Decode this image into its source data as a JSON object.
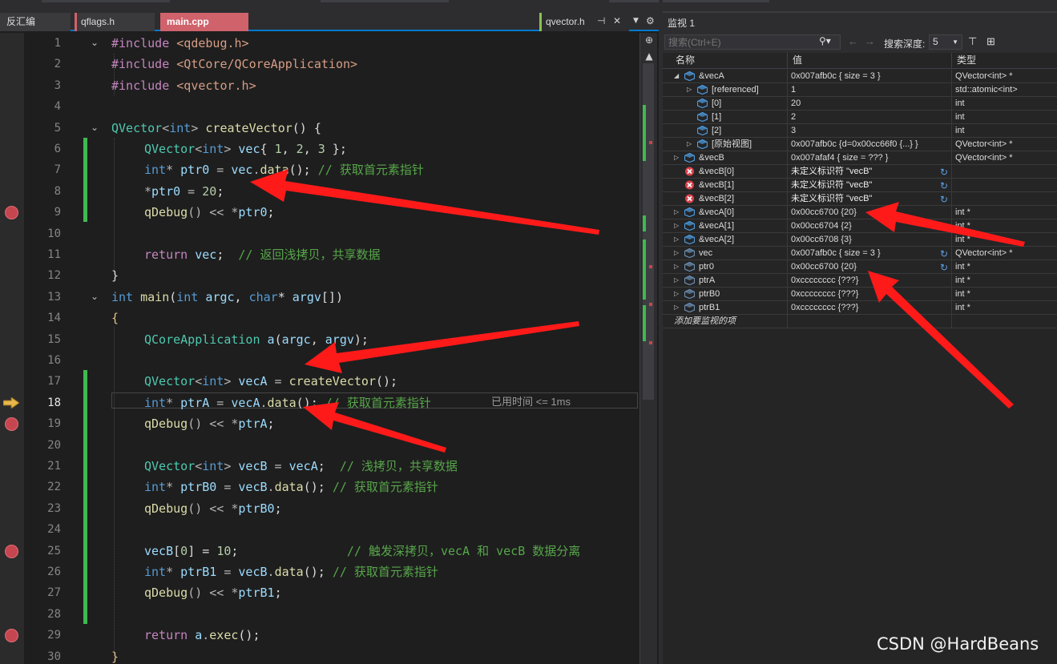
{
  "tabs": {
    "disasm": "反汇编",
    "qflags": "qflags.h",
    "main": "main.cpp",
    "qvector": "qvector.h"
  },
  "editor": {
    "timing_text": "已用时间 <= 1ms",
    "lines": [
      {
        "n": "1"
      },
      {
        "n": "2"
      },
      {
        "n": "3"
      },
      {
        "n": "4"
      },
      {
        "n": "5"
      },
      {
        "n": "6"
      },
      {
        "n": "7"
      },
      {
        "n": "8"
      },
      {
        "n": "9"
      },
      {
        "n": "10"
      },
      {
        "n": "11"
      },
      {
        "n": "12"
      },
      {
        "n": "13"
      },
      {
        "n": "14"
      },
      {
        "n": "15"
      },
      {
        "n": "16"
      },
      {
        "n": "17"
      },
      {
        "n": "18"
      },
      {
        "n": "19"
      },
      {
        "n": "20"
      },
      {
        "n": "21"
      },
      {
        "n": "22"
      },
      {
        "n": "23"
      },
      {
        "n": "24"
      },
      {
        "n": "25"
      },
      {
        "n": "26"
      },
      {
        "n": "27"
      },
      {
        "n": "28"
      },
      {
        "n": "29"
      },
      {
        "n": "30"
      }
    ],
    "code": {
      "l1": [
        "#include",
        " <qdebug.h>"
      ],
      "l2": [
        "#include",
        " <QtCore/QCoreApplication>"
      ],
      "l3": [
        "#include",
        " <qvector.h>"
      ],
      "l5": [
        "QVector",
        "<",
        "int",
        "> ",
        "createVector",
        "() {"
      ],
      "l6": [
        "QVector",
        "<",
        "int",
        "> ",
        "vec",
        "{ ",
        "1",
        ", ",
        "2",
        ", ",
        "3",
        " };"
      ],
      "l7": [
        "int",
        "* ",
        "ptr0",
        " = ",
        "vec",
        ".",
        "data",
        "(); ",
        "// 获取首元素指针"
      ],
      "l8": [
        "*",
        "ptr0",
        " = ",
        "20",
        ";"
      ],
      "l9": [
        "qDebug",
        "() << *",
        "ptr0",
        ";"
      ],
      "l11": [
        "return",
        " ",
        "vec",
        ";  ",
        "// 返回浅拷贝，共享数据"
      ],
      "l12": [
        "}"
      ],
      "l13": [
        "int",
        " ",
        "main",
        "(",
        "int",
        " ",
        "argc",
        ", ",
        "char",
        "* ",
        "argv",
        "[])"
      ],
      "l14": [
        "{"
      ],
      "l15": [
        "QCoreApplication",
        " ",
        "a",
        "(",
        "argc",
        ", ",
        "argv",
        ");"
      ],
      "l17": [
        "QVector",
        "<",
        "int",
        "> ",
        "vecA",
        " = ",
        "createVector",
        "();"
      ],
      "l18": [
        "int",
        "* ",
        "ptrA",
        " = ",
        "vecA",
        ".",
        "data",
        "(); ",
        "// 获取首元素指针"
      ],
      "l19": [
        "qDebug",
        "() << *",
        "ptrA",
        ";"
      ],
      "l21": [
        "QVector",
        "<",
        "int",
        "> ",
        "vecB",
        " = ",
        "vecA",
        ";  ",
        "// 浅拷贝，共享数据"
      ],
      "l22": [
        "int",
        "* ",
        "ptrB0",
        " = ",
        "vecB",
        ".",
        "data",
        "(); ",
        "// 获取首元素指针"
      ],
      "l23": [
        "qDebug",
        "() << *",
        "ptrB0",
        ";"
      ],
      "l25": [
        "vecB",
        "[",
        "0",
        "] = ",
        "10",
        ";",
        "               ",
        "// 触发深拷贝，vecA 和 vecB 数据分离"
      ],
      "l26": [
        "int",
        "* ",
        "ptrB1",
        " = ",
        "vecB",
        ".",
        "data",
        "(); ",
        "// 获取首元素指针"
      ],
      "l27": [
        "qDebug",
        "() << *",
        "ptrB1",
        ";"
      ],
      "l29": [
        "return",
        " ",
        "a",
        ".",
        "exec",
        "();"
      ],
      "l30": [
        "}"
      ]
    }
  },
  "watch": {
    "title": "监视 1",
    "search_placeholder": "搜索(Ctrl+E)",
    "search_depth_label": "搜索深度:",
    "search_depth_value": "5",
    "columns": {
      "name": "名称",
      "value": "值",
      "type": "类型"
    },
    "rows": [
      {
        "name": "&vecA",
        "value": "0x007afb0c { size = 3 }",
        "type": "QVector<int> *"
      },
      {
        "name": "[referenced]",
        "value": "1",
        "type": "std::atomic<int>"
      },
      {
        "name": "[0]",
        "value": "20",
        "type": "int"
      },
      {
        "name": "[1]",
        "value": "2",
        "type": "int"
      },
      {
        "name": "[2]",
        "value": "3",
        "type": "int"
      },
      {
        "name": "[原始视图]",
        "value": "0x007afb0c {d=0x00cc66f0 {...} }",
        "type": "QVector<int> *"
      },
      {
        "name": "&vecB",
        "value": "0x007afaf4 { size = ??? }",
        "type": "QVector<int> *"
      },
      {
        "name": "&vecB[0]",
        "value": "未定义标识符 \"vecB\"",
        "type": ""
      },
      {
        "name": "&vecB[1]",
        "value": "未定义标识符 \"vecB\"",
        "type": ""
      },
      {
        "name": "&vecB[2]",
        "value": "未定义标识符 \"vecB\"",
        "type": ""
      },
      {
        "name": "&vecA[0]",
        "value": "0x00cc6700 {20}",
        "type": "int *"
      },
      {
        "name": "&vecA[1]",
        "value": "0x00cc6704 {2}",
        "type": "int *"
      },
      {
        "name": "&vecA[2]",
        "value": "0x00cc6708 {3}",
        "type": "int *"
      },
      {
        "name": "vec",
        "value": "0x007afb0c { size = 3 }",
        "type": "QVector<int> *"
      },
      {
        "name": "ptr0",
        "value": "0x00cc6700 {20}",
        "type": "int *"
      },
      {
        "name": "ptrA",
        "value": "0xcccccccc {???}",
        "type": "int *"
      },
      {
        "name": "ptrB0",
        "value": "0xcccccccc {???}",
        "type": "int *"
      },
      {
        "name": "ptrB1",
        "value": "0xcccccccc {???}",
        "type": "int *"
      }
    ],
    "add_item_placeholder": "添加要监视的项"
  },
  "watermark": "CSDN @HardBeans",
  "colors": {
    "arrow": "#ff2020",
    "breakpoint": "#c5464f",
    "active_tab": "#d0626b",
    "change_bar": "#3fb950"
  }
}
